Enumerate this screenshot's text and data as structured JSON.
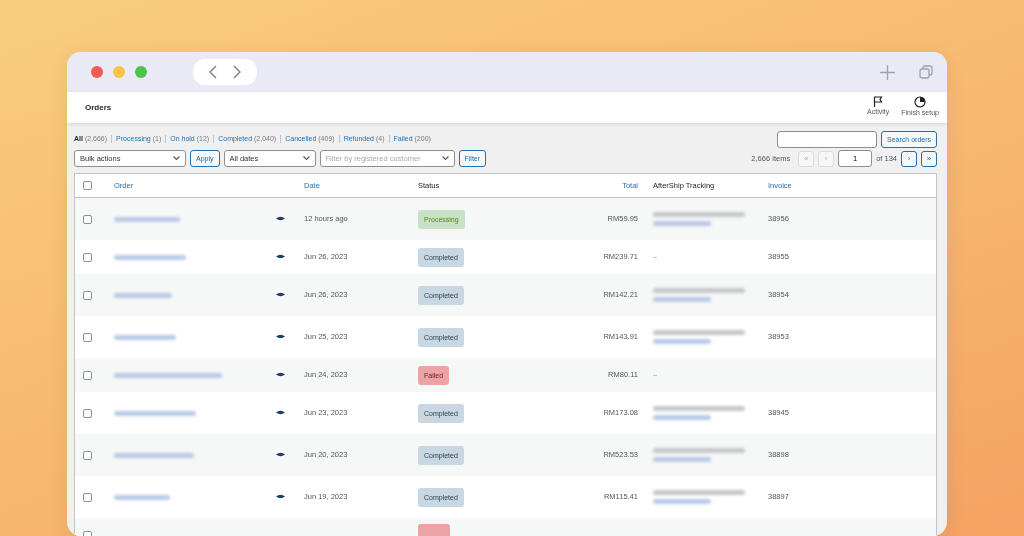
{
  "page": {
    "title": "Orders"
  },
  "header_actions": [
    {
      "label": "Activity",
      "kind": "flag"
    },
    {
      "label": "Finish setup",
      "kind": "progress"
    }
  ],
  "status_views": [
    {
      "label": "All",
      "count": "(2,666)",
      "selected": true
    },
    {
      "label": "Processing",
      "count": "(1)",
      "selected": false
    },
    {
      "label": "On hold",
      "count": "(12)",
      "selected": false
    },
    {
      "label": "Completed",
      "count": "(2,040)",
      "selected": false
    },
    {
      "label": "Cancelled",
      "count": "(409)",
      "selected": false
    },
    {
      "label": "Refunded",
      "count": "(4)",
      "selected": false
    },
    {
      "label": "Failed",
      "count": "(200)",
      "selected": false
    }
  ],
  "search": {
    "button": "Search orders"
  },
  "filters": [
    {
      "kind": "select",
      "value": "Bulk actions"
    },
    {
      "kind": "button",
      "label": "Apply"
    },
    {
      "kind": "select",
      "value": "All dates"
    },
    {
      "kind": "select",
      "placeholder": "Filter by registered customer"
    },
    {
      "kind": "button",
      "label": "Filter"
    }
  ],
  "pagination": {
    "items": "2,666 items",
    "page": "1",
    "of": "of 134",
    "buttons": [
      {
        "label": "«",
        "disabled": true
      },
      {
        "label": "‹",
        "disabled": true
      },
      {
        "label": "›",
        "disabled": false
      },
      {
        "label": "»",
        "disabled": false
      }
    ]
  },
  "table": {
    "select_all_checked": false,
    "columns": [
      {
        "label": "Order",
        "sortable": true
      },
      {
        "label": "Date",
        "sortable": true
      },
      {
        "label": "Status",
        "sortable": false
      },
      {
        "label": "Total",
        "sortable": true
      },
      {
        "label": "AfterShip Tracking",
        "sortable": false
      },
      {
        "label": "Invoice",
        "sortable": true
      }
    ],
    "rows": [
      {
        "checked": false,
        "date": "12 hours ago",
        "status": {
          "label": "Processing",
          "color": "#c6e1c6"
        },
        "total": "RM59.95",
        "tracking_redacted": true,
        "invoice": "38956"
      },
      {
        "checked": false,
        "date": "Jun 26, 2023",
        "status": {
          "label": "Completed",
          "color": "#c8d7e1"
        },
        "total": "RM239.71",
        "tracking_redacted": false,
        "invoice": "38955"
      },
      {
        "checked": false,
        "date": "Jun 26, 2023",
        "status": {
          "label": "Completed",
          "color": "#c8d7e1"
        },
        "total": "RM142.21",
        "tracking_redacted": true,
        "invoice": "38954"
      },
      {
        "checked": false,
        "date": "Jun 25, 2023",
        "status": {
          "label": "Completed",
          "color": "#c8d7e1"
        },
        "total": "RM143.91",
        "tracking_redacted": true,
        "invoice": "38953"
      },
      {
        "checked": false,
        "date": "Jun 24, 2023",
        "status": {
          "label": "Failed",
          "color": "#eba3a3"
        },
        "total": "RM80.11",
        "tracking_redacted": false
      },
      {
        "checked": false,
        "date": "Jun 23, 2023",
        "status": {
          "label": "Completed",
          "color": "#c8d7e1"
        },
        "total": "RM173.08",
        "tracking_redacted": true,
        "invoice": "38945"
      },
      {
        "checked": false,
        "date": "Jun 20, 2023",
        "status": {
          "label": "Completed",
          "color": "#c8d7e1"
        },
        "total": "RM523.53",
        "tracking_redacted": true,
        "invoice": "38898"
      },
      {
        "checked": false,
        "date": "Jun 19, 2023",
        "status": {
          "label": "Completed",
          "color": "#c8d7e1"
        },
        "total": "RM115.41",
        "tracking_redacted": true,
        "invoice": "38897"
      },
      {
        "checked": false,
        "status": {
          "color": "#eba3a3"
        }
      }
    ]
  }
}
